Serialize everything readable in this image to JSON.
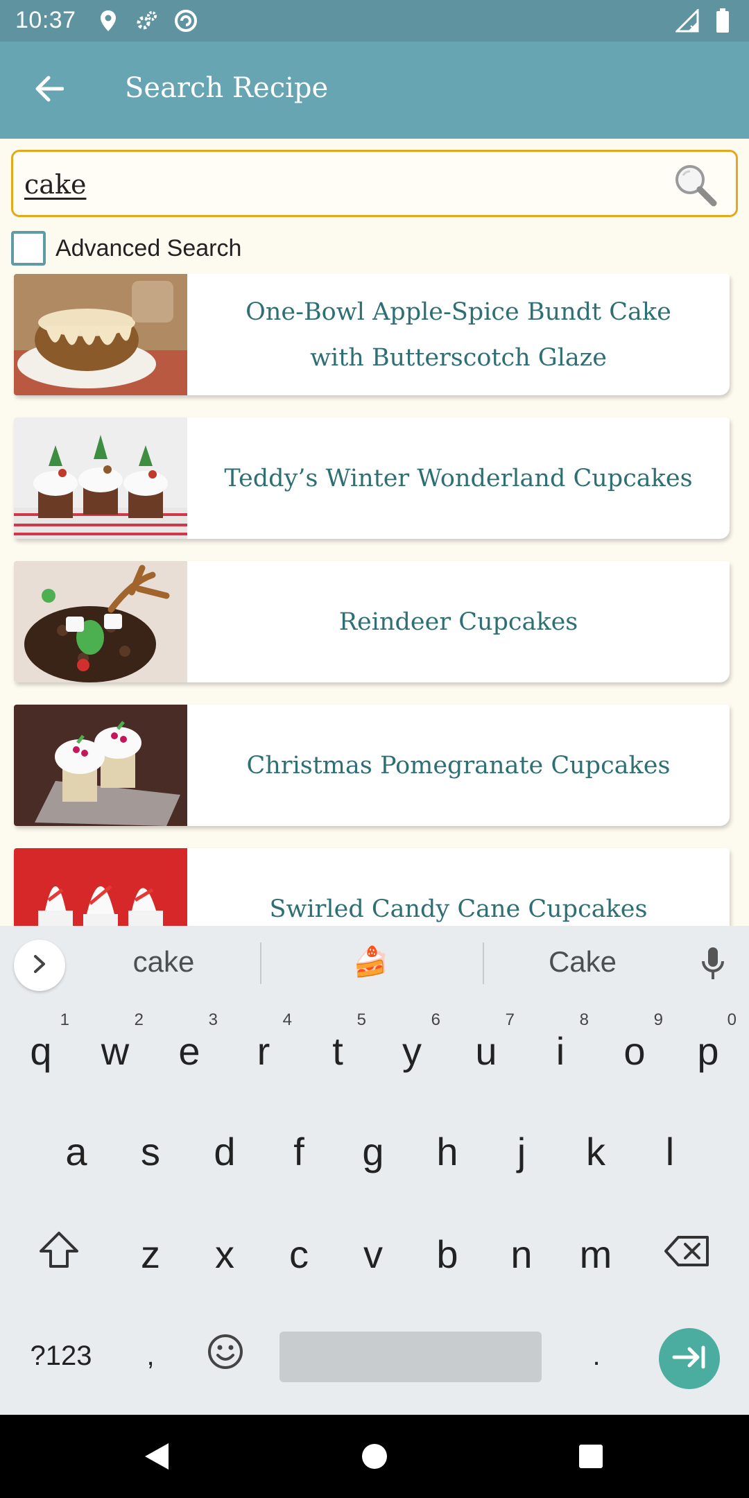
{
  "status_bar": {
    "time": "10:37"
  },
  "app_bar": {
    "title": "Search Recipe"
  },
  "search": {
    "value": "cake"
  },
  "advanced_search": {
    "label": "Advanced Search",
    "checked": false
  },
  "recipes": [
    {
      "title": "One-Bowl Apple-Spice Bundt Cake with Butterscotch Glaze"
    },
    {
      "title": "Teddy’s Winter Wonderland Cupcakes"
    },
    {
      "title": "Reindeer Cupcakes"
    },
    {
      "title": "Christmas Pomegranate Cupcakes"
    },
    {
      "title": "Swirled Candy Cane Cupcakes"
    }
  ],
  "keyboard": {
    "suggestions": [
      "cake",
      "🍰",
      "Cake"
    ],
    "row1": [
      {
        "k": "q",
        "n": "1"
      },
      {
        "k": "w",
        "n": "2"
      },
      {
        "k": "e",
        "n": "3"
      },
      {
        "k": "r",
        "n": "4"
      },
      {
        "k": "t",
        "n": "5"
      },
      {
        "k": "y",
        "n": "6"
      },
      {
        "k": "u",
        "n": "7"
      },
      {
        "k": "i",
        "n": "8"
      },
      {
        "k": "o",
        "n": "9"
      },
      {
        "k": "p",
        "n": "0"
      }
    ],
    "row2": [
      "a",
      "s",
      "d",
      "f",
      "g",
      "h",
      "j",
      "k",
      "l"
    ],
    "row3": [
      "z",
      "x",
      "c",
      "v",
      "b",
      "n",
      "m"
    ],
    "symbols_label": "?123",
    "comma": ",",
    "period": "."
  },
  "colors": {
    "status_bar": "#5e939f",
    "app_bar": "#67a5b3",
    "accent": "#e3a91b",
    "title_text": "#2e6f74",
    "enter_key": "#4aad9f"
  }
}
